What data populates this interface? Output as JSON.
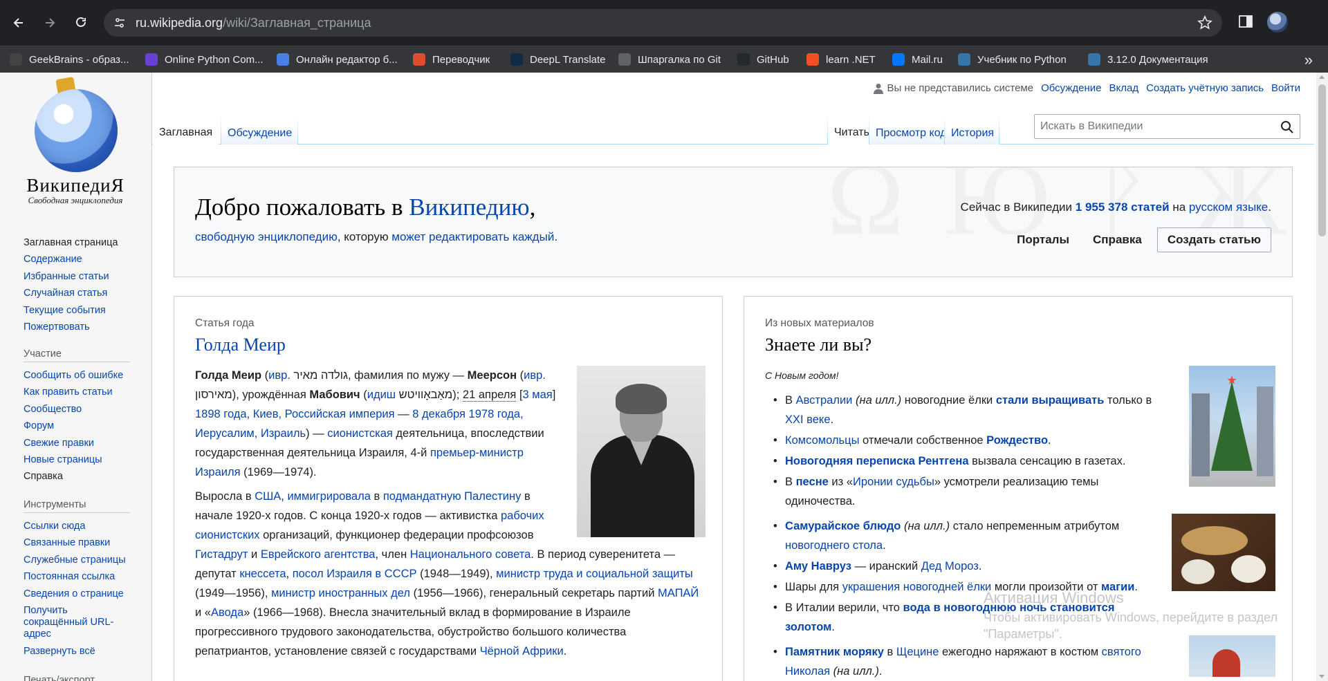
{
  "browser": {
    "url_domain": "ru.wikipedia.org",
    "url_path": "/wiki/Заглавная_страница",
    "bookmarks": [
      {
        "label": "GeekBrains - образ...",
        "icon": "geekbrains-icon",
        "color": "#444444"
      },
      {
        "label": "Online Python Com...",
        "icon": "python-compiler-icon",
        "color": "#6a3fd6"
      },
      {
        "label": "Онлайн редактор б...",
        "icon": "editor-icon",
        "color": "#4a7fe8"
      },
      {
        "label": "Переводчик",
        "icon": "translator-icon",
        "color": "#e04a2f"
      },
      {
        "label": "DeepL Translate",
        "icon": "deepl-icon",
        "color": "#0f2b46"
      },
      {
        "label": "Шпаргалка по Git",
        "icon": "globe-icon",
        "color": "#5f6368"
      },
      {
        "label": "GitHub",
        "icon": "github-icon",
        "color": "#24292e"
      },
      {
        "label": "learn .NET",
        "icon": "microsoft-icon",
        "color": "#f25022"
      },
      {
        "label": "Mail.ru",
        "icon": "mailru-icon",
        "color": "#0078ff"
      },
      {
        "label": "Учебник по Python",
        "icon": "python-icon",
        "color": "#3776ab"
      },
      {
        "label": "3.12.0 Документация",
        "icon": "python-docs-icon",
        "color": "#3776ab"
      }
    ]
  },
  "header": {
    "anon_text": "Вы не представились системе",
    "links": [
      "Обсуждение",
      "Вклад",
      "Создать учётную запись",
      "Войти"
    ]
  },
  "logo": {
    "title": "ВикипедиЯ",
    "tagline": "Свободная энциклопедия"
  },
  "sidebar": {
    "main": [
      "Заглавная страница",
      "Содержание",
      "Избранные статьи",
      "Случайная статья",
      "Текущие события",
      "Пожертвовать"
    ],
    "participation_heading": "Участие",
    "participation": [
      "Сообщить об ошибке",
      "Как править статьи",
      "Сообщество",
      "Форум",
      "Свежие правки",
      "Новые страницы",
      "Справка"
    ],
    "tools_heading": "Инструменты",
    "tools": [
      "Ссылки сюда",
      "Связанные правки",
      "Служебные страницы",
      "Постоянная ссылка",
      "Сведения о странице",
      "Получить сокращённый URL-адрес",
      "Развернуть всё"
    ],
    "print_heading": "Печать/экспорт"
  },
  "tabs": {
    "left": [
      "Заглавная",
      "Обсуждение"
    ],
    "right": [
      "Читать",
      "Просмотр кода",
      "История"
    ]
  },
  "search": {
    "placeholder": "Искать в Википедии"
  },
  "welcome": {
    "title_prefix": "Добро пожаловать в ",
    "title_link": "Википедию",
    "title_suffix": ",",
    "sub_link1": "свободную энциклопедию",
    "sub_mid": ", которую ",
    "sub_link2": "может редактировать каждый",
    "sub_end": ".",
    "stats_prefix": "Сейчас в Википедии ",
    "stats_count": "1 955 378 статей",
    "stats_mid": " на ",
    "stats_lang": "русском языке",
    "stats_end": ".",
    "portals": "Порталы",
    "help": "Справка",
    "create": "Создать статью"
  },
  "featured": {
    "kicker": "Статья года",
    "title": "Голда Меир",
    "p1": [
      {
        "t": "Голда Меир",
        "s": "b"
      },
      {
        "t": " ("
      },
      {
        "t": "ивр.",
        "s": "a"
      },
      {
        "t": " גולדה מאיר, фамилия по мужу — "
      },
      {
        "t": "Меерсон",
        "s": "b"
      },
      {
        "t": " ("
      },
      {
        "t": "ивр.",
        "s": "a"
      },
      {
        "t": " מאירסון), урождённая "
      },
      {
        "t": "Мабович",
        "s": "b"
      },
      {
        "t": " ("
      },
      {
        "t": "идиш",
        "s": "a"
      },
      {
        "t": " מאַבאָוויטש); "
      },
      {
        "t": "21 апреля",
        "s": "d"
      },
      {
        "t": " ["
      },
      {
        "t": "3 мая",
        "s": "a"
      },
      {
        "t": "] "
      },
      {
        "t": "1898 года, Киев, Российская империя",
        "s": "a"
      },
      {
        "t": " — "
      },
      {
        "t": "8 декабря 1978 года, Иерусалим, Израиль",
        "s": "a"
      },
      {
        "t": ") — "
      },
      {
        "t": "сионистская",
        "s": "a"
      },
      {
        "t": " деятельница, впоследствии государственная деятельница Израиля, 4-й "
      },
      {
        "t": "премьер-министр Израиля",
        "s": "a"
      },
      {
        "t": " (1969—1974)."
      }
    ],
    "p2": [
      {
        "t": "Выросла в "
      },
      {
        "t": "США",
        "s": "a"
      },
      {
        "t": ", "
      },
      {
        "t": "иммигрировала",
        "s": "a"
      },
      {
        "t": " в "
      },
      {
        "t": "подмандатную Палестину",
        "s": "a"
      },
      {
        "t": " в начале 1920-х годов. С конца 1920-х годов — активистка "
      },
      {
        "t": "рабочих сионистских",
        "s": "a"
      },
      {
        "t": " организаций, функционер федерации профсоюзов "
      },
      {
        "t": "Гистадрут",
        "s": "a"
      },
      {
        "t": " и "
      },
      {
        "t": "Еврейского агентства",
        "s": "a"
      },
      {
        "t": ", член "
      },
      {
        "t": "Национального совета",
        "s": "a"
      },
      {
        "t": ". В период суверенитета — депутат "
      },
      {
        "t": "кнессета",
        "s": "a"
      },
      {
        "t": ", "
      },
      {
        "t": "посол Израиля в СССР",
        "s": "a"
      },
      {
        "t": " (1948—1949), "
      },
      {
        "t": "министр труда и социальной защиты",
        "s": "a"
      },
      {
        "t": " (1949—1956), "
      },
      {
        "t": "министр иностранных дел",
        "s": "a"
      },
      {
        "t": " (1956—1966), генеральный секретарь партий "
      },
      {
        "t": "МАПАЙ",
        "s": "a"
      },
      {
        "t": " и «"
      },
      {
        "t": "Авода",
        "s": "a"
      },
      {
        "t": "» (1966—1968). Внесла значительный вклад в формирование в Израиле прогрессивного трудового законодательства, обустройство большого количества репатриантов, установление связей с государствами "
      },
      {
        "t": "Чёрной Африки",
        "s": "a"
      },
      {
        "t": "."
      }
    ]
  },
  "dyk": {
    "kicker": "Из новых материалов",
    "title": "Знаете ли вы?",
    "greeting": "С Новым годом!",
    "items": [
      [
        {
          "t": "В "
        },
        {
          "t": "Австралии",
          "s": "a"
        },
        {
          "t": " (на илл.)",
          "s": "i"
        },
        {
          "t": " новогодние ёлки "
        },
        {
          "t": "стали выращивать",
          "s": "ab"
        },
        {
          "t": " только в "
        },
        {
          "t": "XXI веке",
          "s": "a"
        },
        {
          "t": "."
        }
      ],
      [
        {
          "t": "Комсомольцы",
          "s": "a"
        },
        {
          "t": " отмечали собственное "
        },
        {
          "t": "Рождество",
          "s": "ab"
        },
        {
          "t": "."
        }
      ],
      [
        {
          "t": "Новогодняя переписка Рентгена",
          "s": "ab"
        },
        {
          "t": " вызвала сенсацию в газетах."
        }
      ],
      [
        {
          "t": "В "
        },
        {
          "t": "песне",
          "s": "ab"
        },
        {
          "t": " из «"
        },
        {
          "t": "Иронии судьбы",
          "s": "a"
        },
        {
          "t": "» усмотрели реализацию темы одиночества."
        }
      ],
      [
        {
          "t": "Самурайское блюдо",
          "s": "ab"
        },
        {
          "t": " (на илл.)",
          "s": "i"
        },
        {
          "t": " стало непременным атрибутом "
        },
        {
          "t": "новогоднего стола",
          "s": "a"
        },
        {
          "t": "."
        }
      ],
      [
        {
          "t": "Аму Навруз",
          "s": "ab"
        },
        {
          "t": " — иранский "
        },
        {
          "t": "Дед Мороз",
          "s": "a"
        },
        {
          "t": "."
        }
      ],
      [
        {
          "t": "Шары для "
        },
        {
          "t": "украшения новогодней ёлки",
          "s": "a"
        },
        {
          "t": " могли произойти от "
        },
        {
          "t": "магии",
          "s": "ab"
        },
        {
          "t": "."
        }
      ],
      [
        {
          "t": "В Италии верили, что "
        },
        {
          "t": "вода в новогоднюю ночь становится золотом",
          "s": "ab"
        },
        {
          "t": "."
        }
      ],
      [
        {
          "t": "Памятник моряку",
          "s": "ab"
        },
        {
          "t": " в "
        },
        {
          "t": "Щецине",
          "s": "a"
        },
        {
          "t": " ежегодно наряжают в костюм "
        },
        {
          "t": "святого Николая",
          "s": "a"
        },
        {
          "t": " (на илл.)",
          "s": "i"
        },
        {
          "t": "."
        }
      ]
    ]
  },
  "watermark": {
    "title": "Активация Windows",
    "line1": "Чтобы активировать Windows, перейдите в раздел",
    "line2": "\"Параметры\"."
  }
}
